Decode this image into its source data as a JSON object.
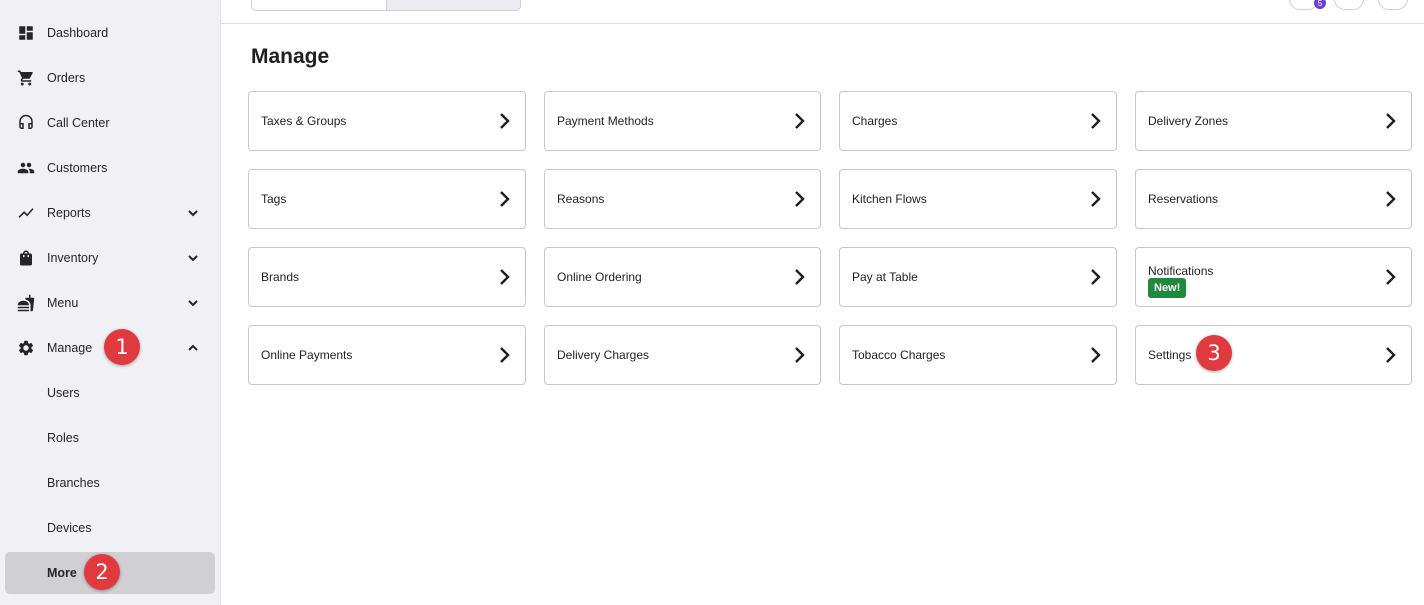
{
  "sidebar": {
    "items": [
      {
        "label": "Dashboard",
        "icon": "dashboard-icon"
      },
      {
        "label": "Orders",
        "icon": "cart-icon"
      },
      {
        "label": "Call Center",
        "icon": "headset-icon"
      },
      {
        "label": "Customers",
        "icon": "people-icon"
      },
      {
        "label": "Reports",
        "icon": "chart-line-icon",
        "expandable": true
      },
      {
        "label": "Inventory",
        "icon": "bag-icon",
        "expandable": true
      },
      {
        "label": "Menu",
        "icon": "food-icon",
        "expandable": true
      },
      {
        "label": "Manage",
        "icon": "gear-icon",
        "expandable": true,
        "expanded": true
      }
    ],
    "manage_subitems": [
      {
        "label": "Users"
      },
      {
        "label": "Roles"
      },
      {
        "label": "Branches"
      },
      {
        "label": "Devices"
      },
      {
        "label": "More",
        "active": true
      }
    ]
  },
  "topbar": {
    "notification_count": "5"
  },
  "main": {
    "title": "Manage",
    "cards": [
      {
        "label": "Taxes & Groups"
      },
      {
        "label": "Payment Methods"
      },
      {
        "label": "Charges"
      },
      {
        "label": "Delivery Zones"
      },
      {
        "label": "Tags"
      },
      {
        "label": "Reasons"
      },
      {
        "label": "Kitchen Flows"
      },
      {
        "label": "Reservations"
      },
      {
        "label": "Brands"
      },
      {
        "label": "Online Ordering"
      },
      {
        "label": "Pay at Table"
      },
      {
        "label": "Notifications",
        "badge": "New!"
      },
      {
        "label": "Online Payments"
      },
      {
        "label": "Delivery Charges"
      },
      {
        "label": "Tobacco Charges"
      },
      {
        "label": "Settings"
      }
    ]
  },
  "annotations": {
    "step1": "1",
    "step2": "2",
    "step3": "3"
  },
  "colors": {
    "sidebar_bg": "#f1f1f5",
    "active_item_bg": "#cfcfd4",
    "step_badge": "#e03a3e",
    "new_badge": "#1f8a3c",
    "notification_badge": "#6b3fd4"
  }
}
